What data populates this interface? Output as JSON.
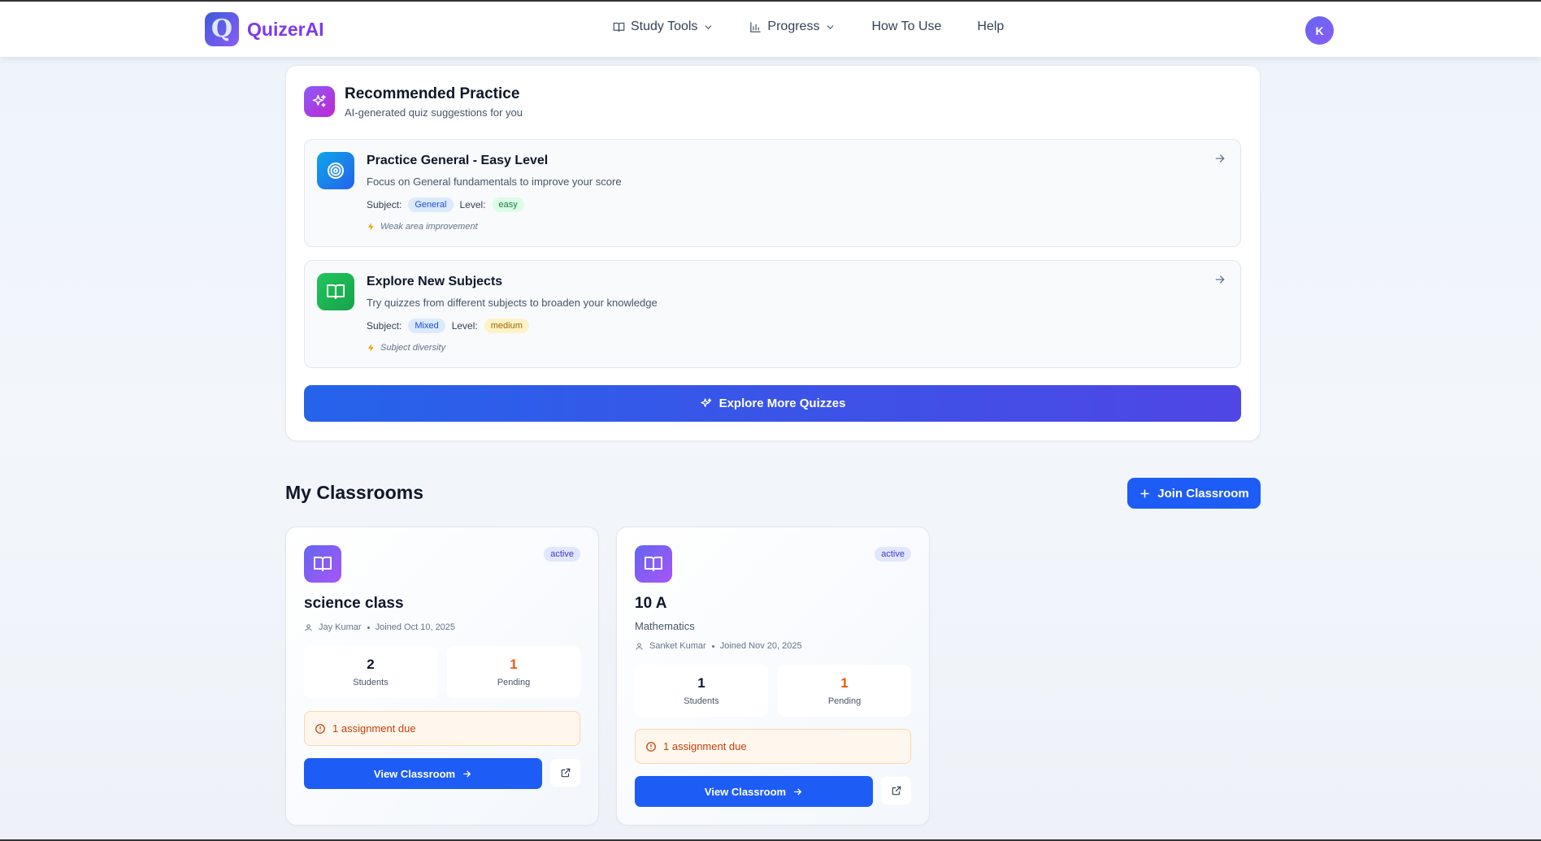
{
  "navbar": {
    "brand": "QuizerAI",
    "logo_letter": "Q",
    "links": [
      {
        "label": "Study Tools",
        "icon": "book-icon",
        "dropdown": true
      },
      {
        "label": "Progress",
        "icon": "bar-chart-icon",
        "dropdown": true
      },
      {
        "label": "How To Use",
        "dropdown": false
      },
      {
        "label": "Help",
        "dropdown": false
      }
    ],
    "avatar_initial": "K"
  },
  "recommended": {
    "title": "Recommended Practice",
    "subtitle": "AI-generated quiz suggestions for you",
    "items": [
      {
        "title": "Practice General - Easy Level",
        "description": "Focus on General fundamentals to improve your score",
        "subject_label": "Subject:",
        "subject": "General",
        "level_label": "Level:",
        "level": "easy",
        "note": "Weak area improvement",
        "icon": "target-icon",
        "color": "#0ea5e9"
      },
      {
        "title": "Explore New Subjects",
        "description": "Try quizzes from different subjects to broaden your knowledge",
        "subject_label": "Subject:",
        "subject": "Mixed",
        "level_label": "Level:",
        "level": "medium",
        "note": "Subject diversity",
        "icon": "book-open-icon",
        "color": "#22c55e"
      }
    ],
    "explore_button": "Explore More Quizzes"
  },
  "classrooms": {
    "title": "My Classrooms",
    "join_button": "Join Classroom",
    "cards": [
      {
        "name": "science class",
        "status": "active",
        "subject": "",
        "teacher": "Jay Kumar",
        "joined": "Joined Oct 10, 2025",
        "students": "2",
        "students_label": "Students",
        "pending": "1",
        "pending_label": "Pending",
        "due": "1 assignment due",
        "view_button": "View Classroom"
      },
      {
        "name": "10 A",
        "status": "active",
        "subject": "Mathematics",
        "teacher": "Sanket Kumar",
        "joined": "Joined Nov 20, 2025",
        "students": "1",
        "students_label": "Students",
        "pending": "1",
        "pending_label": "Pending",
        "due": "1 assignment due",
        "view_button": "View Classroom"
      }
    ]
  },
  "colors": {
    "primary": "#1d5cf5",
    "brand": "#7c3aed",
    "pending": "#ea580c"
  }
}
